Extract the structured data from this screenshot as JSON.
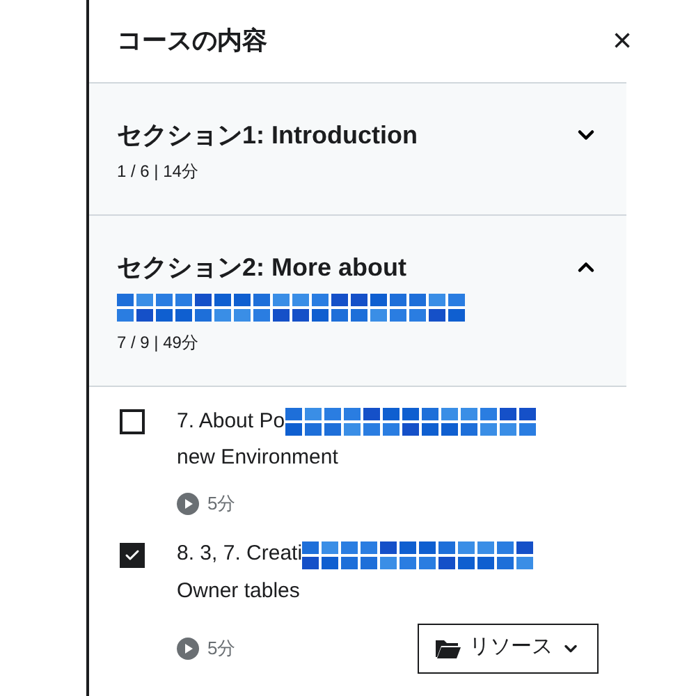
{
  "panel": {
    "title": "コースの内容",
    "close": "×"
  },
  "sections": [
    {
      "title": "セクション1: Introduction",
      "title_redacted": false,
      "progress": "1 / 6 | 14分",
      "expanded": false
    },
    {
      "title": "セクション2: More about",
      "title_redacted": true,
      "progress": "7 / 9 | 49分",
      "expanded": true
    }
  ],
  "lectures": [
    {
      "title_line_1": "7. About Po",
      "title_line_2": "new Environment",
      "duration": "5分",
      "checked": false,
      "has_resources": false
    },
    {
      "title_line_1": "8. 3, 7. Creati",
      "title_line_2": "Owner tables",
      "duration": "5分",
      "checked": true,
      "has_resources": true,
      "resources_label": "リソース"
    }
  ]
}
